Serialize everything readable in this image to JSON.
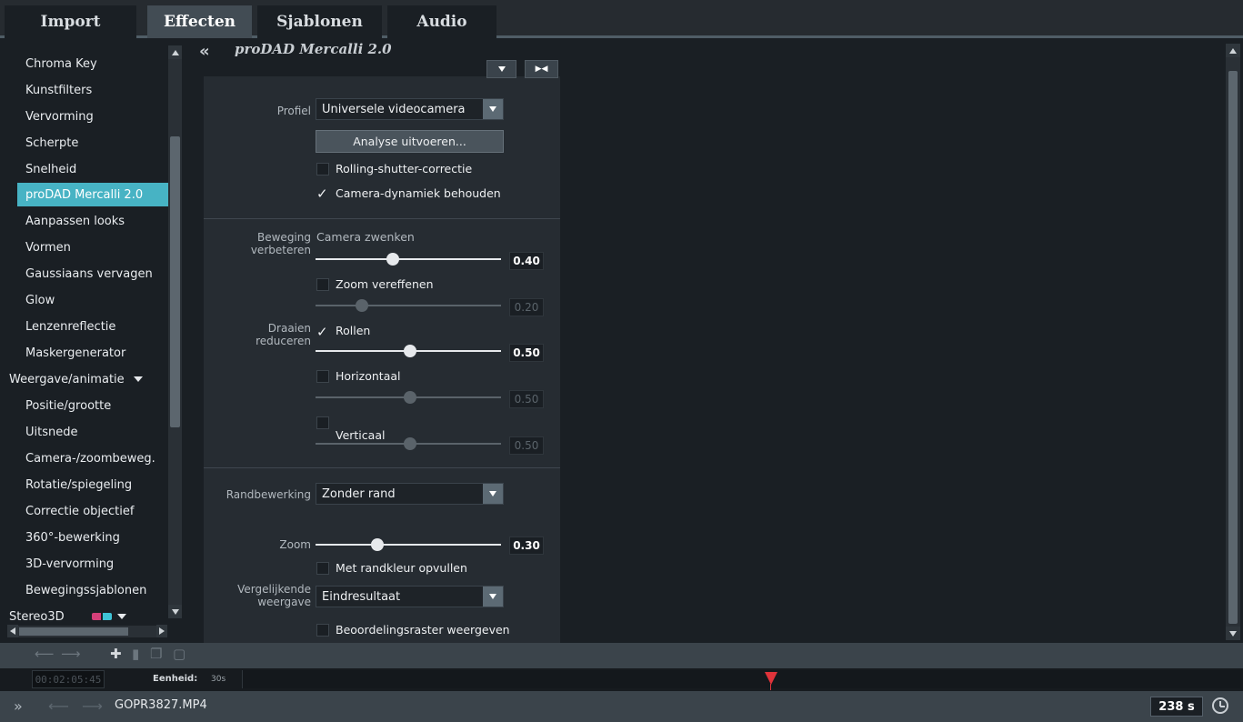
{
  "tabs": [
    "Import",
    "Effecten",
    "Sjablonen",
    "Audio"
  ],
  "active_tab": "Effecten",
  "sidebar": {
    "items": [
      {
        "label": "Chroma Key",
        "kind": "sub"
      },
      {
        "label": "Kunstfilters",
        "kind": "sub"
      },
      {
        "label": "Vervorming",
        "kind": "sub"
      },
      {
        "label": "Scherpte",
        "kind": "sub"
      },
      {
        "label": "Snelheid",
        "kind": "sub"
      },
      {
        "label": "proDAD Mercalli 2.0",
        "kind": "selected"
      },
      {
        "label": "Aanpassen looks",
        "kind": "sub"
      },
      {
        "label": "Vormen",
        "kind": "sub"
      },
      {
        "label": "Gaussiaans vervagen",
        "kind": "sub"
      },
      {
        "label": "Glow",
        "kind": "sub"
      },
      {
        "label": "Lenzenreflectie",
        "kind": "sub"
      },
      {
        "label": "Maskergenerator",
        "kind": "sub"
      },
      {
        "label": "Weergave/animatie",
        "kind": "group"
      },
      {
        "label": "Positie/grootte",
        "kind": "sub"
      },
      {
        "label": "Uitsnede",
        "kind": "sub"
      },
      {
        "label": "Camera-/zoombeweg.",
        "kind": "sub"
      },
      {
        "label": "Rotatie/spiegeling",
        "kind": "sub"
      },
      {
        "label": "Correctie objectief",
        "kind": "sub"
      },
      {
        "label": "360°-bewerking",
        "kind": "sub"
      },
      {
        "label": "3D-vervorming",
        "kind": "sub"
      },
      {
        "label": "Bewegingssjablonen",
        "kind": "sub"
      },
      {
        "label": "Stereo3D",
        "kind": "group"
      }
    ]
  },
  "effect": {
    "title": "proDAD Mercalli 2.0",
    "profile_label": "Profiel",
    "profile_value": "Universele videocamera",
    "analyse_button": "Analyse uitvoeren...",
    "rolling_shutter": {
      "label": "Rolling-shutter-correctie",
      "checked": false
    },
    "camera_dynamics": {
      "label": "Camera-dynamiek behouden",
      "checked": true
    },
    "motion_label_1": "Beweging",
    "motion_label_2": "verbeteren",
    "pan_label": "Camera zwenken",
    "pan_value": "0.40",
    "zoom_smooth": {
      "label": "Zoom vereffenen",
      "checked": false
    },
    "zoom_smooth_value": "0.20",
    "rotate_label_1": "Draaien",
    "rotate_label_2": "reduceren",
    "roll": {
      "label": "Rollen",
      "checked": true
    },
    "roll_value": "0.50",
    "horizontal": {
      "label": "Horizontaal",
      "checked": false
    },
    "horizontal_value": "0.50",
    "vertical": {
      "label": "Verticaal",
      "checked": false
    },
    "vertical_value": "0.50",
    "edge_label": "Randbewerking",
    "edge_value": "Zonder rand",
    "zoom_label": "Zoom",
    "zoom_value": "0.30",
    "fill_border": {
      "label": "Met randkleur opvullen",
      "checked": false
    },
    "compare_label_1": "Vergelijkende",
    "compare_label_2": "weergave",
    "compare_value": "Eindresultaat",
    "grid": {
      "label": "Beoordelingsraster weergeven",
      "checked": false
    }
  },
  "timeline": {
    "timecode": "00:02:05:45",
    "unit_label": "Eenheid:",
    "unit_value": "30s"
  },
  "status": {
    "filename": "GOPR3827.MP4",
    "duration": "238 s"
  },
  "colors": {
    "accent": "#47b3c4",
    "playhead": "#e0333a"
  }
}
